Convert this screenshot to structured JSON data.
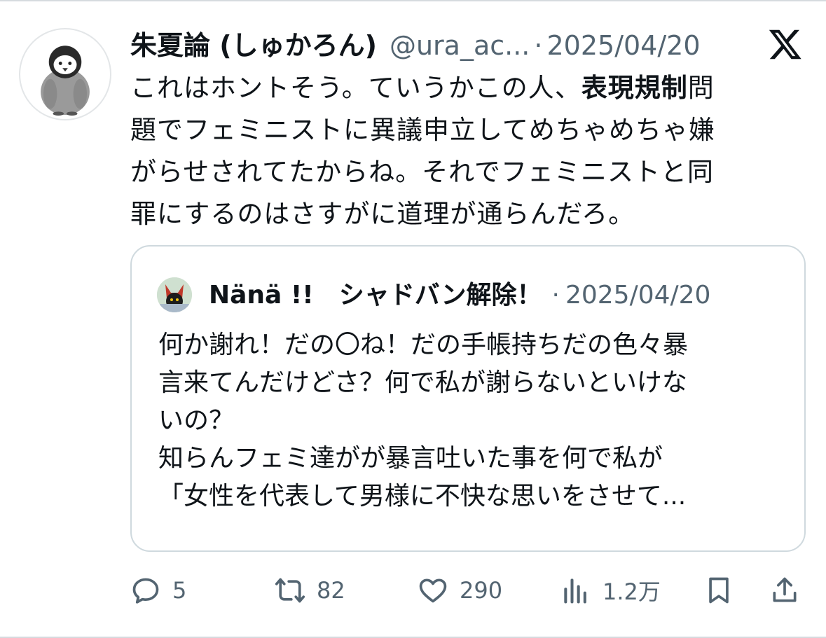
{
  "post": {
    "display_name": "朱夏論 (しゅかろん)",
    "handle": "@ura_ac...",
    "separator": "·",
    "date": "2025/04/20",
    "text_line1_pre": "これはホントそう。ていうかこの人、",
    "text_line1_bold": "表現規制",
    "text_line1_post": "問",
    "text_line2": "題でフェミニストに異議申立してめちゃめちゃ嫌",
    "text_line3": "がらせされてたからね。それでフェミニストと同",
    "text_line4": "罪にするのはさすがに道理が通らんだろ。"
  },
  "quote": {
    "display_name": "Nänä !!　シャドバン解除！",
    "separator": "·",
    "date": "2025/04/20",
    "lines": [
      "何か謝れ！だの〇ね！だの手帳持ちだの色々暴",
      "言来てんだけどさ？何で私が謝らないといけな",
      "いの？",
      "知らんフェミ達がが暴言吐いた事を何で私が",
      "「女性を代表して男様に不快な思いをさせて..."
    ]
  },
  "actions": {
    "replies": "5",
    "reposts": "82",
    "likes": "290",
    "views": "1.2万"
  },
  "colors": {
    "text": "#0f1419",
    "secondary": "#536471",
    "border": "#cfd9de"
  },
  "icons": [
    "x-logo-icon",
    "reply-icon",
    "repost-icon",
    "like-icon",
    "views-icon",
    "bookmark-icon",
    "share-icon"
  ]
}
